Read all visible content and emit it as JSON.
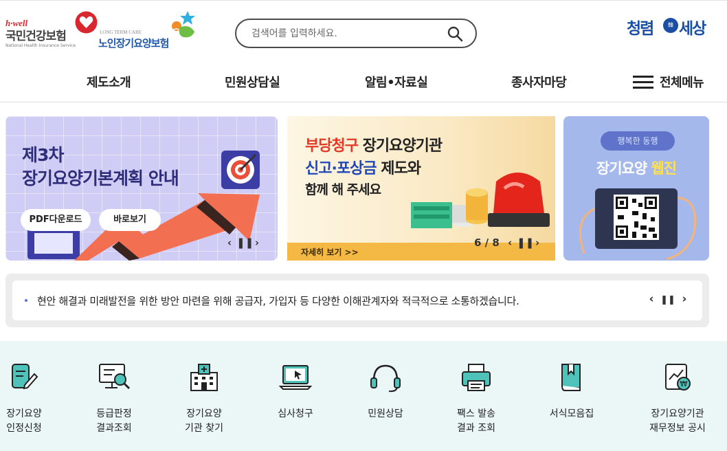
{
  "header": {
    "nhis_logo": {
      "tagline": "h·well",
      "name": "국민건강보험",
      "name_en": "National Health Insurance Service"
    },
    "ltc_logo": {
      "name_en": "LONG TERM CARE",
      "name": "노인장기요양보험"
    },
    "search": {
      "placeholder": "검색어를 입력하세요.",
      "icon": "search-icon"
    },
    "clean_logo": {
      "part1": "청렴",
      "badge": "韓",
      "part2": "세상"
    }
  },
  "nav": {
    "items": [
      "제도소개",
      "민원상담실",
      "알림•자료실",
      "종사자마당"
    ],
    "all_menu_label": "전체메뉴",
    "all_menu_icon": "hamburger-icon"
  },
  "banners": {
    "left": {
      "title_line1": "제3차",
      "title_line2": "장기요양기본계획 안내",
      "button_pdf": "PDF다운로드",
      "button_view": "바로보기",
      "bg_color": "#cfcdf6"
    },
    "center": {
      "line1_red": "부당청구",
      "line1_rest": " 장기요양기관",
      "line2_blue": "신고·포상금",
      "line2_rest": " 제도와",
      "line3": "함께 해 주세요",
      "more_label": "자세히 보기 >>",
      "page_indicator": "6 / 8"
    },
    "right": {
      "tag": "행복한 동행",
      "title_white": "장기요양 ",
      "title_yellow": "웹진"
    }
  },
  "notice": {
    "text": "현안 해결과 미래발전을 위한 방안 마련을 위해 공급자, 가입자 등 다양한 이해관계자와 적극적으로 소통하겠습니다."
  },
  "quick_menu": [
    {
      "label": "장기요양\n인정신청",
      "icon": "application-pen-icon"
    },
    {
      "label": "등급판정\n결과조회",
      "icon": "monitor-search-icon"
    },
    {
      "label": "장기요양\n기관 찾기",
      "icon": "hospital-building-icon"
    },
    {
      "label": "심사청구",
      "icon": "laptop-cursor-icon"
    },
    {
      "label": "민원상담",
      "icon": "headset-icon"
    },
    {
      "label": "팩스 발송\n결과 조회",
      "icon": "fax-printer-icon"
    },
    {
      "label": "서식모음집",
      "icon": "book-icon"
    },
    {
      "label": "장기요양기관\n재무정보 공시",
      "icon": "finance-chart-icon"
    }
  ],
  "colors": {
    "accent_teal": "#1f9e9a",
    "nav_blue": "#1a4fa3",
    "quick_bg": "#ebf6f6"
  }
}
